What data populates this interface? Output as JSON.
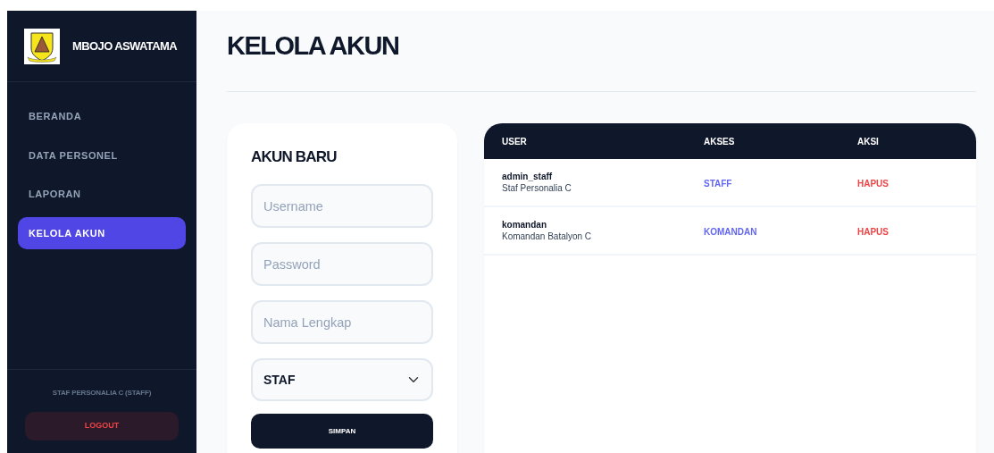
{
  "sidebar": {
    "brand": "MBOJO ASWATAMA",
    "items": [
      {
        "label": "BERANDA",
        "selected": false
      },
      {
        "label": "DATA PERSONEL",
        "selected": false
      },
      {
        "label": "LAPORAN",
        "selected": false
      },
      {
        "label": "KELOLA AKUN",
        "selected": true
      }
    ],
    "user_label": "STAF PERSONALIA C (STAFF)",
    "logout": "LOGOUT"
  },
  "page_title": "KELOLA AKUN",
  "form": {
    "title": "AKUN BARU",
    "fields": [
      {
        "placeholder": "Username"
      },
      {
        "placeholder": "Password"
      },
      {
        "placeholder": "Nama Lengkap"
      }
    ],
    "select": {
      "value": "STAF"
    },
    "submit": "SIMPAN"
  },
  "table": {
    "columns": [
      "USER",
      "AKSES",
      "AKSI"
    ],
    "rows": [
      {
        "username": "admin_staff",
        "full_name": "Staf Personalia C",
        "access": "STAFF",
        "action": "HAPUS"
      },
      {
        "username": "komandan",
        "full_name": "Komandan Batalyon C",
        "access": "KOMANDAN",
        "action": "HAPUS"
      }
    ]
  }
}
